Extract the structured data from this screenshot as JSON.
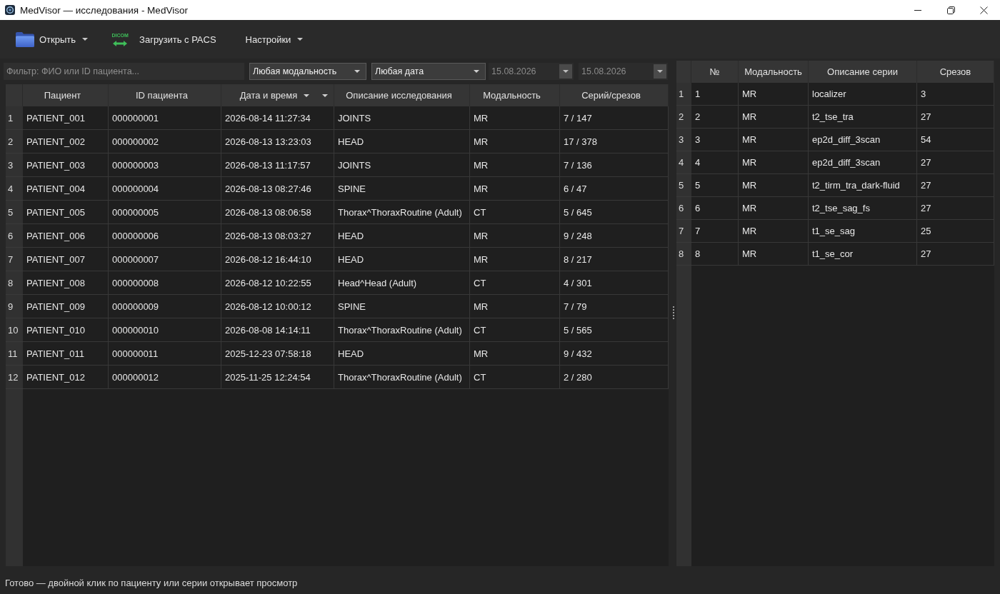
{
  "window": {
    "title": "MedVisor — исследования - MedVisor"
  },
  "toolbar": [
    {
      "label": "Открыть",
      "kind": "open",
      "dropdown": true
    },
    {
      "label": "Загрузить с PACS",
      "kind": "import",
      "badge": "DICOM",
      "dropdown": false
    },
    {
      "label": "Настройки",
      "kind": "settings",
      "dropdown": true
    }
  ],
  "filters": {
    "search": {
      "placeholder": "Фильтр: ФИО или ID пациента..."
    },
    "modality": {
      "value": "Любая модальность"
    },
    "period": {
      "value": "Любая дата"
    },
    "date_from": {
      "value": "15.08.2026",
      "disabled": true
    },
    "date_to": {
      "value": "15.08.2026",
      "disabled": true
    }
  },
  "studies_table": {
    "columns": [
      {
        "label": "Пациент",
        "sorted": false,
        "menu": false
      },
      {
        "label": "ID пациента",
        "sorted": false,
        "menu": false
      },
      {
        "label": "Дата и время",
        "sorted": true,
        "menu": true
      },
      {
        "label": "Описание исследования",
        "sorted": false,
        "menu": false
      },
      {
        "label": "Модальность",
        "sorted": false,
        "menu": false
      },
      {
        "label": "Серий/срезов",
        "sorted": false,
        "menu": false
      }
    ],
    "rows": [
      {
        "number": "1",
        "cells": [
          "PATIENT_001",
          "000000001",
          "2026-08-14 11:27:34",
          "JOINTS",
          "MR",
          "7 / 147"
        ]
      },
      {
        "number": "2",
        "cells": [
          "PATIENT_002",
          "000000002",
          "2026-08-13 13:23:03",
          "HEAD",
          "MR",
          "17 / 378"
        ]
      },
      {
        "number": "3",
        "cells": [
          "PATIENT_003",
          "000000003",
          "2026-08-13 11:17:57",
          "JOINTS",
          "MR",
          "7 / 136"
        ]
      },
      {
        "number": "4",
        "cells": [
          "PATIENT_004",
          "000000004",
          "2026-08-13 08:27:46",
          "SPINE",
          "MR",
          "6 / 47"
        ]
      },
      {
        "number": "5",
        "cells": [
          "PATIENT_005",
          "000000005",
          "2026-08-13 08:06:58",
          "Thorax^ThoraxRoutine (Adult)",
          "CT",
          "5 / 645"
        ]
      },
      {
        "number": "6",
        "cells": [
          "PATIENT_006",
          "000000006",
          "2026-08-13 08:03:27",
          "HEAD",
          "MR",
          "9 / 248"
        ]
      },
      {
        "number": "7",
        "cells": [
          "PATIENT_007",
          "000000007",
          "2026-08-12 16:44:10",
          "HEAD",
          "MR",
          "8 / 217"
        ]
      },
      {
        "number": "8",
        "cells": [
          "PATIENT_008",
          "000000008",
          "2026-08-12 10:22:55",
          "Head^Head (Adult)",
          "CT",
          "4 / 301"
        ]
      },
      {
        "number": "9",
        "cells": [
          "PATIENT_009",
          "000000009",
          "2026-08-12 10:00:12",
          "SPINE",
          "MR",
          "7 / 79"
        ]
      },
      {
        "number": "10",
        "cells": [
          "PATIENT_010",
          "000000010",
          "2026-08-08 14:14:11",
          "Thorax^ThoraxRoutine (Adult)",
          "CT",
          "5 / 565"
        ]
      },
      {
        "number": "11",
        "cells": [
          "PATIENT_011",
          "000000011",
          "2025-12-23 07:58:18",
          "HEAD",
          "MR",
          "9 / 432"
        ]
      },
      {
        "number": "12",
        "cells": [
          "PATIENT_012",
          "000000012",
          "2025-11-25 12:24:54",
          "Thorax^ThoraxRoutine (Adult)",
          "CT",
          "2 / 280"
        ]
      }
    ]
  },
  "series_table": {
    "columns": [
      "№",
      "Модальность",
      "Описание серии",
      "Срезов"
    ],
    "rows": [
      {
        "number": "1",
        "cells": [
          "1",
          "MR",
          "localizer",
          "3"
        ]
      },
      {
        "number": "2",
        "cells": [
          "2",
          "MR",
          "t2_tse_tra",
          "27"
        ]
      },
      {
        "number": "3",
        "cells": [
          "3",
          "MR",
          "ep2d_diff_3scan",
          "54"
        ]
      },
      {
        "number": "4",
        "cells": [
          "4",
          "MR",
          "ep2d_diff_3scan",
          "27"
        ]
      },
      {
        "number": "5",
        "cells": [
          "5",
          "MR",
          "t2_tirm_tra_dark-fluid",
          "27"
        ]
      },
      {
        "number": "6",
        "cells": [
          "6",
          "MR",
          "t2_tse_sag_fs",
          "27"
        ]
      },
      {
        "number": "7",
        "cells": [
          "7",
          "MR",
          "t1_se_sag",
          "25"
        ]
      },
      {
        "number": "8",
        "cells": [
          "8",
          "MR",
          "t1_se_cor",
          "27"
        ]
      }
    ]
  },
  "status_bar": {
    "text": "Готово — двойной клик по пациенту или серии открывает просмотр"
  }
}
